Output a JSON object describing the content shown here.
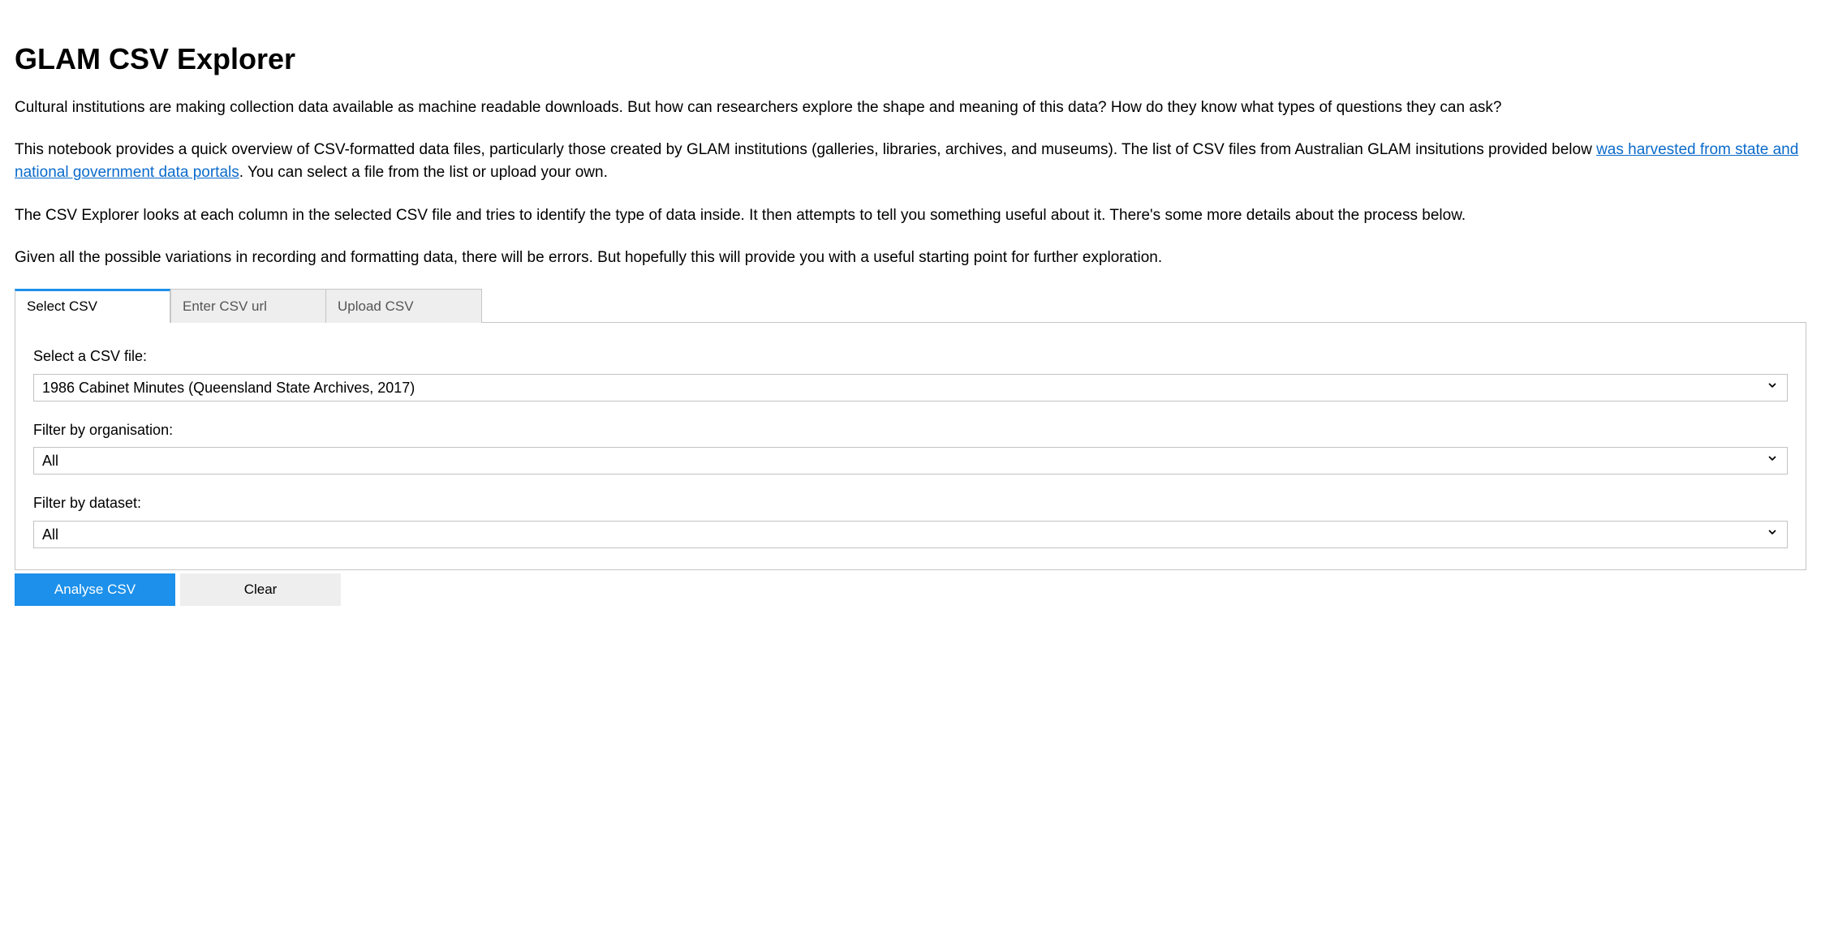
{
  "header": {
    "title": "GLAM CSV Explorer"
  },
  "intro": {
    "p1": "Cultural institutions are making collection data available as machine readable downloads. But how can researchers explore the shape and meaning of this data? How do they know what types of questions they can ask?",
    "p2_before": "This notebook provides a quick overview of CSV-formatted data files, particularly those created by GLAM institutions (galleries, libraries, archives, and museums). The list of CSV files from Australian GLAM insitutions provided below ",
    "p2_link": "was harvested from state and national government data portals",
    "p2_after": ". You can select a file from the list or upload your own.",
    "p3": "The CSV Explorer looks at each column in the selected CSV file and tries to identify the type of data inside. It then attempts to tell you something useful about it. There's some more details about the process below.",
    "p4": "Given all the possible variations in recording and formatting data, there will be errors. But hopefully this will provide you with a useful starting point for further exploration."
  },
  "tabs": {
    "select": "Select CSV",
    "enter": "Enter CSV url",
    "upload": "Upload CSV"
  },
  "form": {
    "file_label": "Select a CSV file:",
    "file_value": "1986 Cabinet Minutes (Queensland State Archives, 2017)",
    "org_label": "Filter by organisation:",
    "org_value": "All",
    "dataset_label": "Filter by dataset:",
    "dataset_value": "All"
  },
  "buttons": {
    "analyse": "Analyse CSV",
    "clear": "Clear"
  }
}
